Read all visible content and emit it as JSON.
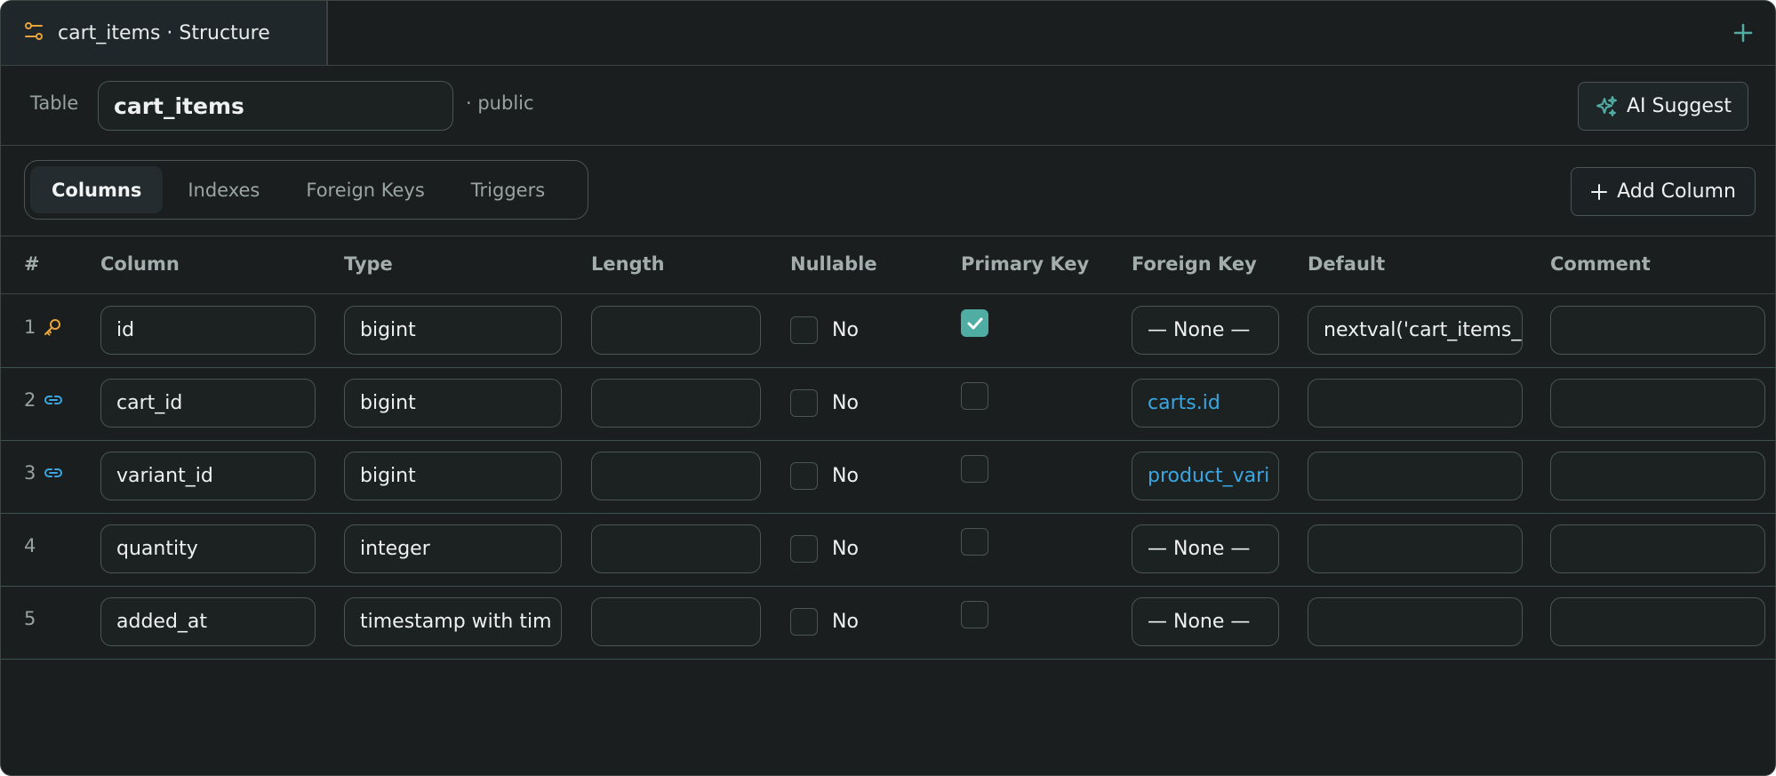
{
  "tab": {
    "title": "cart_items · Structure"
  },
  "table": {
    "label": "Table",
    "name": "cart_items",
    "schema": "· public"
  },
  "ai_suggest_label": "AI Suggest",
  "tabs": [
    {
      "label": "Columns",
      "active": true
    },
    {
      "label": "Indexes",
      "active": false
    },
    {
      "label": "Foreign Keys",
      "active": false
    },
    {
      "label": "Triggers",
      "active": false
    }
  ],
  "add_column_label": "Add Column",
  "headers": {
    "num": "#",
    "column": "Column",
    "type": "Type",
    "length": "Length",
    "nullable": "Nullable",
    "primary_key": "Primary Key",
    "foreign_key": "Foreign Key",
    "default": "Default",
    "comment": "Comment"
  },
  "rows": [
    {
      "num": "1",
      "icon": "key-icon",
      "column": "id",
      "type": "bigint",
      "length": "",
      "nullable_checked": false,
      "nullable_label": "No",
      "primary_key": true,
      "foreign_key": "— None —",
      "fk_linked": false,
      "default": "nextval('cart_items_",
      "comment": ""
    },
    {
      "num": "2",
      "icon": "link-icon",
      "column": "cart_id",
      "type": "bigint",
      "length": "",
      "nullable_checked": false,
      "nullable_label": "No",
      "primary_key": false,
      "foreign_key": "carts.id",
      "fk_linked": true,
      "default": "",
      "comment": ""
    },
    {
      "num": "3",
      "icon": "link-icon",
      "column": "variant_id",
      "type": "bigint",
      "length": "",
      "nullable_checked": false,
      "nullable_label": "No",
      "primary_key": false,
      "foreign_key": "product_vari",
      "fk_linked": true,
      "default": "",
      "comment": ""
    },
    {
      "num": "4",
      "icon": "",
      "column": "quantity",
      "type": "integer",
      "length": "",
      "nullable_checked": false,
      "nullable_label": "No",
      "primary_key": false,
      "foreign_key": "— None —",
      "fk_linked": false,
      "default": "",
      "comment": ""
    },
    {
      "num": "5",
      "icon": "",
      "column": "added_at",
      "type": "timestamp with tim",
      "length": "",
      "nullable_checked": false,
      "nullable_label": "No",
      "primary_key": false,
      "foreign_key": "— None —",
      "fk_linked": false,
      "default": "",
      "comment": ""
    }
  ],
  "colors": {
    "accent": "#4fada4",
    "key": "#e8a33c",
    "link": "#3aa7e3",
    "background": "#1a1e1f"
  }
}
